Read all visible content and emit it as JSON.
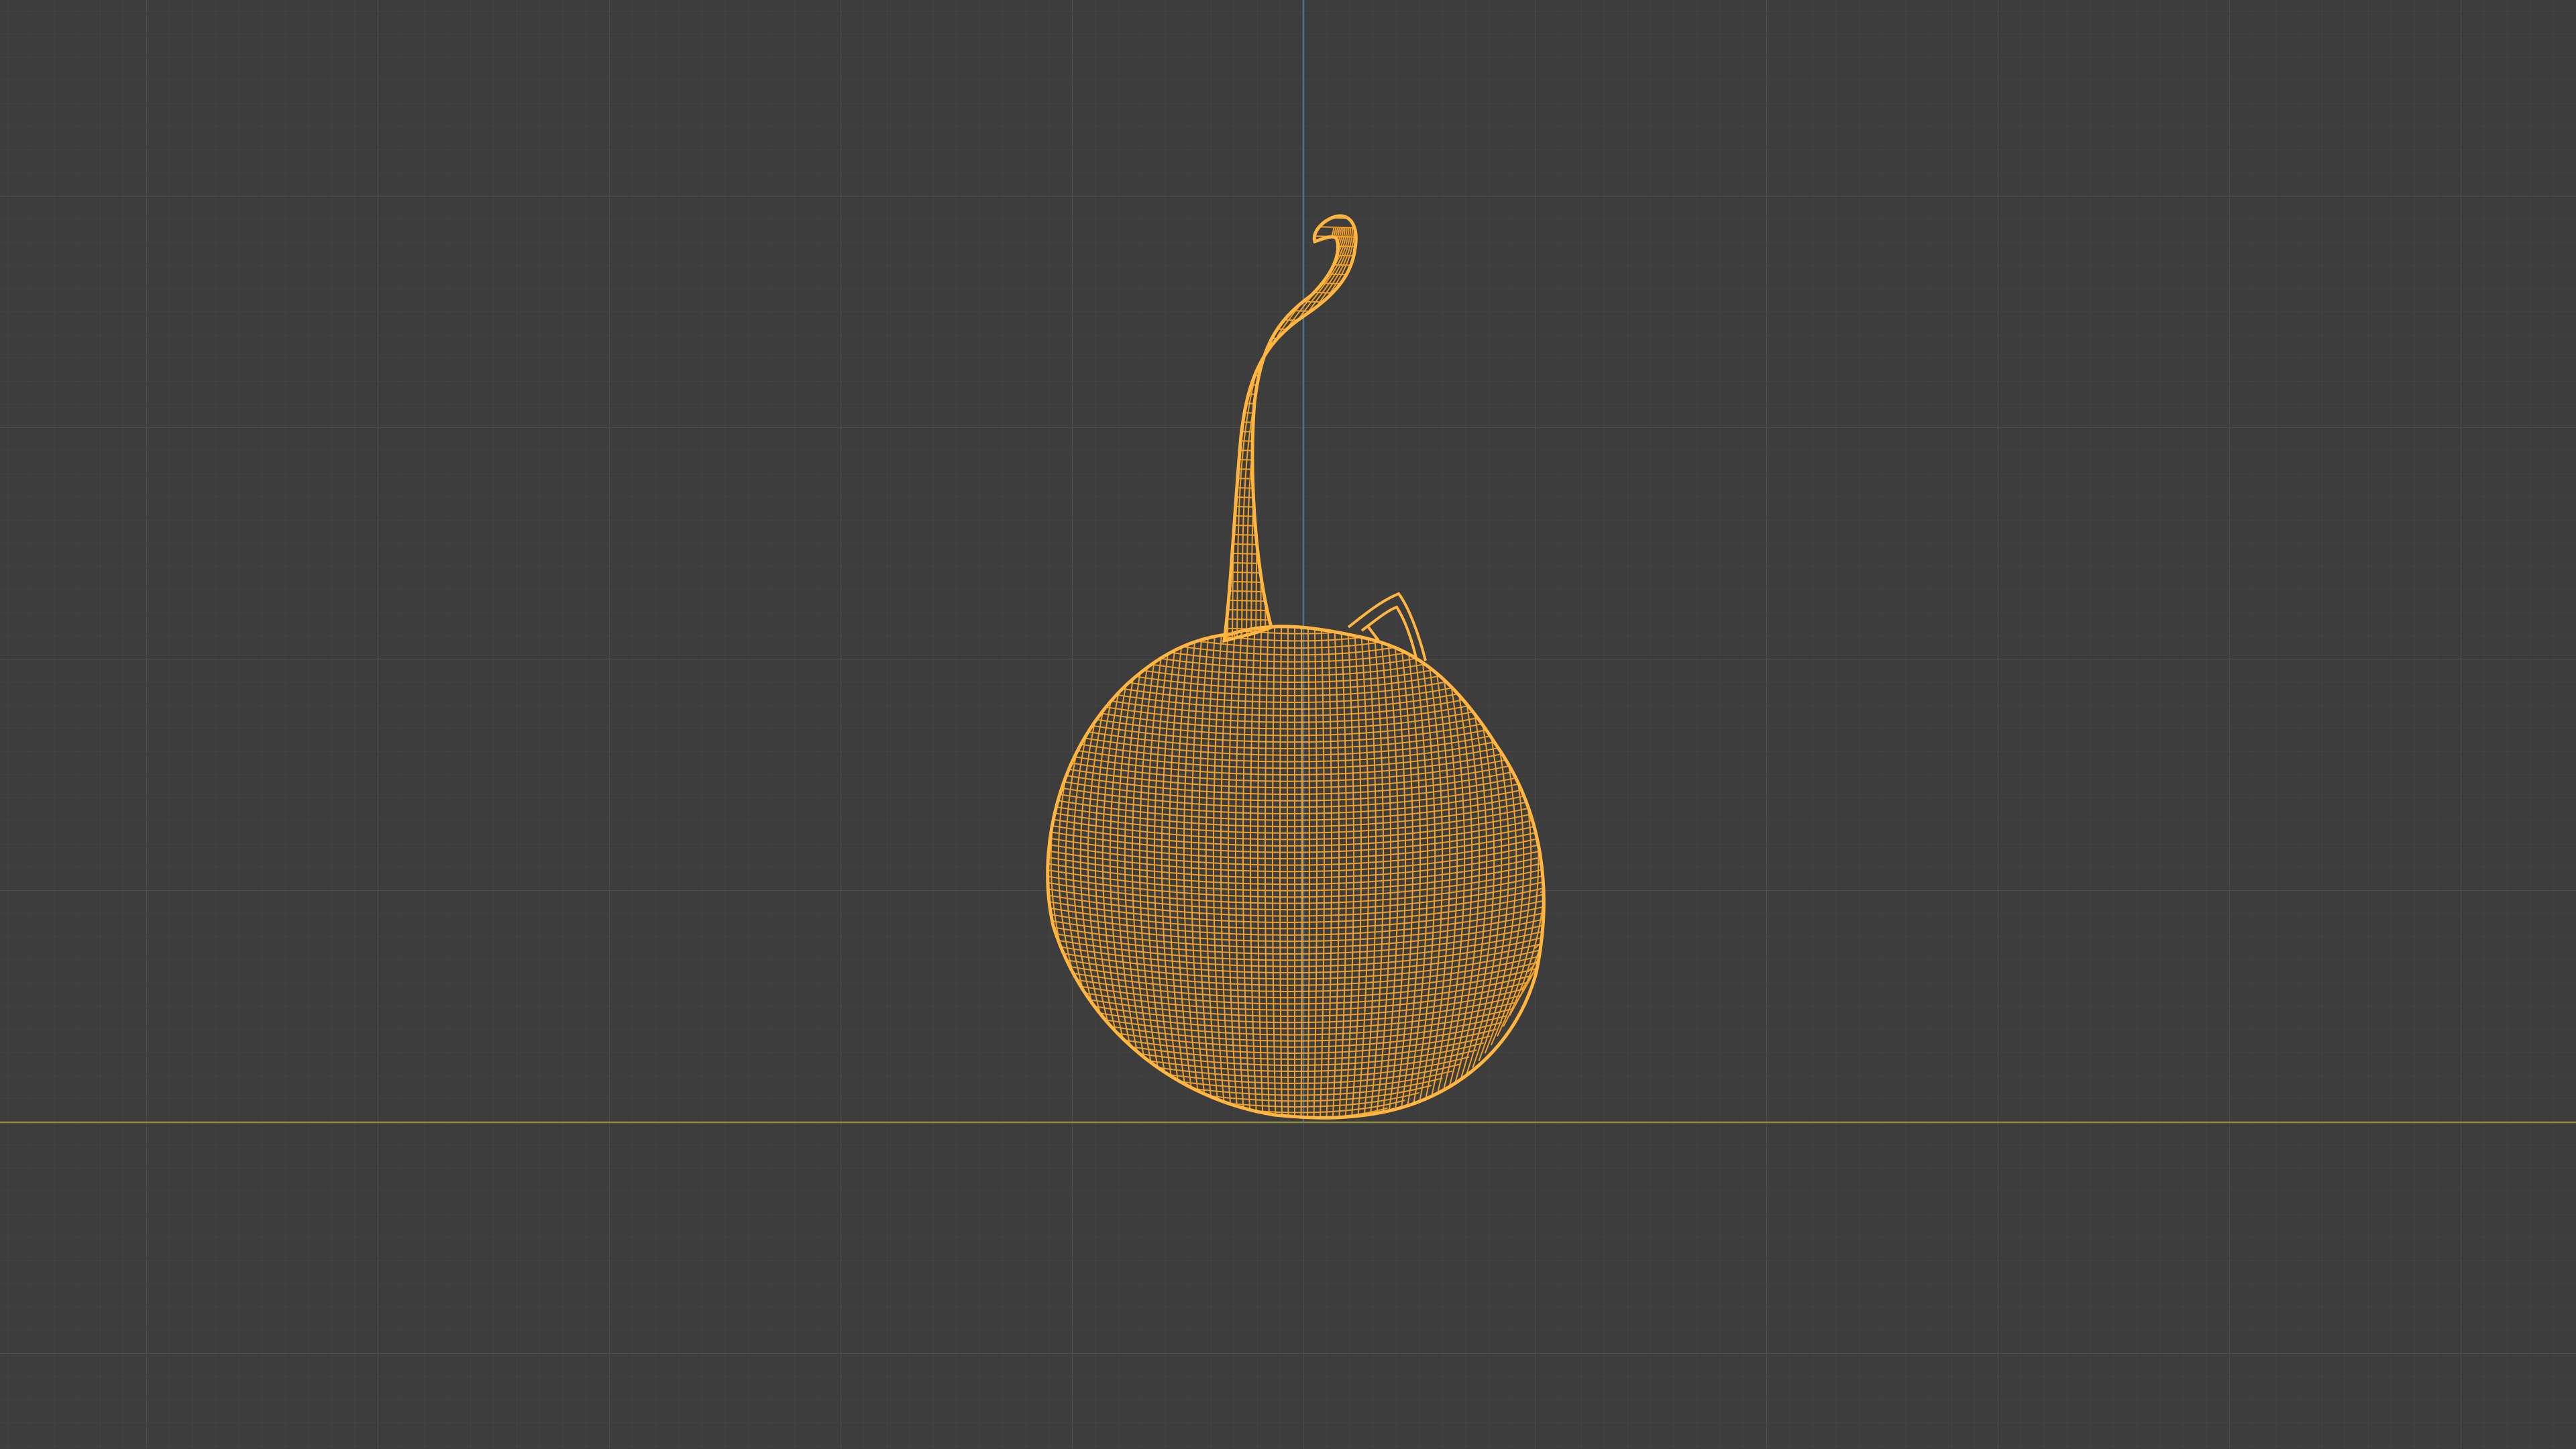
{
  "viewport": {
    "mode": "wireframe",
    "background_color": "#3d3d3d",
    "grid_minor_color": "#454545",
    "grid_major_color": "#4d4d4d",
    "axis_x_color": "#8c8a3a",
    "axis_z_color": "#4f6f8e"
  },
  "object": {
    "kind": "gourd-mesh",
    "selected": true,
    "wire_color": "#f0a02a",
    "outline_color": "#ffb540"
  }
}
